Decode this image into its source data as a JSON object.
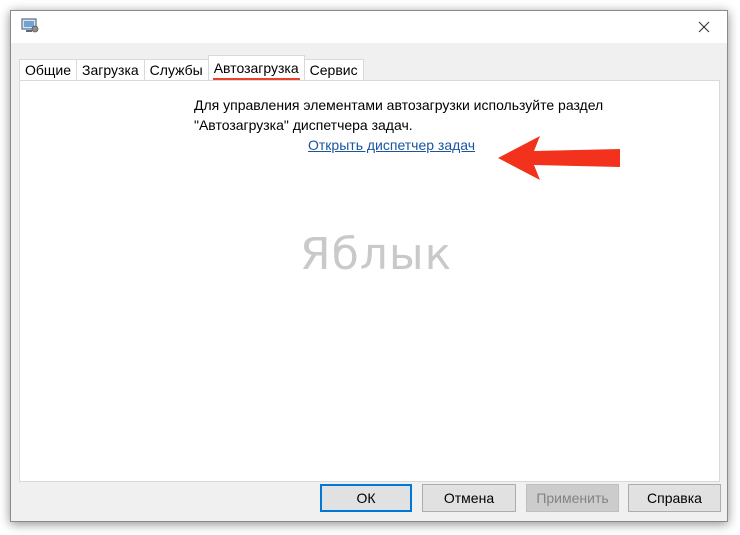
{
  "window": {
    "close_glyph": "✕"
  },
  "tabs": [
    {
      "label": "Общие",
      "active": false
    },
    {
      "label": "Загрузка",
      "active": false
    },
    {
      "label": "Службы",
      "active": false
    },
    {
      "label": "Автозагрузка",
      "active": true
    },
    {
      "label": "Сервис",
      "active": false
    }
  ],
  "startup": {
    "info_line1": "Для управления элементами автозагрузки используйте раздел",
    "info_line2": "\"Автозагрузка\" диспетчера задач.",
    "link_text": "Открыть диспетчер задач"
  },
  "watermark": {
    "text": "Яблык"
  },
  "buttons": {
    "ok": "ОК",
    "cancel": "Отмена",
    "apply": "Применить",
    "help": "Справка"
  },
  "colors": {
    "accent_underline": "#e8412c",
    "arrow": "#f2321c",
    "link": "#1a55a0",
    "default_button_border": "#0078d7"
  },
  "icons": {
    "app": "monitor-settings-icon",
    "close": "close-icon",
    "annotation": "red-arrow-icon"
  }
}
